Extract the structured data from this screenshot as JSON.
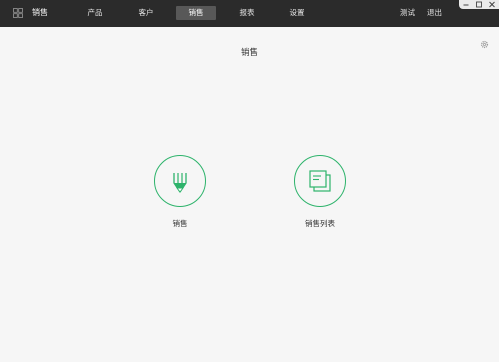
{
  "app": {
    "title": "销售"
  },
  "nav": {
    "items": [
      "产品",
      "客户",
      "销售",
      "报表",
      "设置"
    ],
    "active": "销售"
  },
  "user": {
    "test_label": "测试",
    "logout_label": "退出"
  },
  "page": {
    "title": "销售"
  },
  "tiles": [
    {
      "label": "销售",
      "icon": "pen-icon"
    },
    {
      "label": "销售列表",
      "icon": "list-icon"
    }
  ],
  "colors": {
    "accent": "#2db36b",
    "topbar": "#2b2b2b",
    "nav_active": "#585858",
    "background": "#f6f6f6"
  }
}
